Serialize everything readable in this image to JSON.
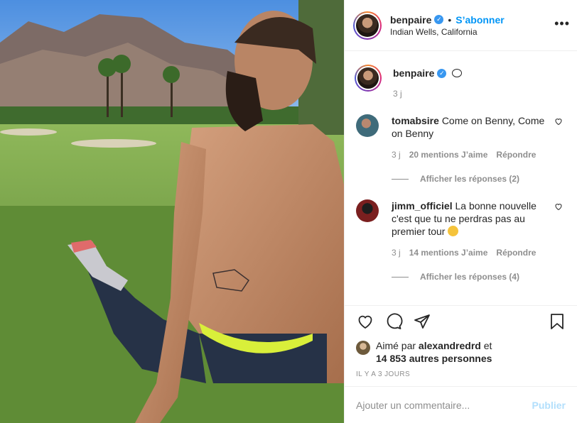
{
  "post": {
    "username": "benpaire",
    "follow_label": "S’abonner",
    "location": "Indian Wells, California",
    "more_label": "•••"
  },
  "caption": {
    "username": "benpaire",
    "time": "3 j"
  },
  "comments": [
    {
      "username": "tomabsire",
      "text": "Come on Benny, Come on Benny",
      "time": "3 j",
      "likes": "20 mentions J’aime",
      "reply_label": "Répondre",
      "view_replies": "Afficher les réponses (2)",
      "avatar_color": "#3f6b7a"
    },
    {
      "username": "jimm_officiel",
      "text": "La bonne nouvelle c'est que tu ne perdras pas au premier tour",
      "time": "3 j",
      "likes": "14 mentions J’aime",
      "reply_label": "Répondre",
      "view_replies": "Afficher les réponses (4)",
      "avatar_color": "#7a1f1f"
    }
  ],
  "likes": {
    "prefix": "Aimé par",
    "user": "alexandredrd",
    "joiner": "et",
    "others": "14 853 autres personnes"
  },
  "ago": "IL Y A 3 JOURS",
  "add_comment": {
    "placeholder": "Ajouter un commentaire...",
    "publish_label": "Publier"
  },
  "colors": {
    "accent": "#0095f6",
    "verified": "#3897f0",
    "muted": "#8e8e8e",
    "publish_disabled": "#b2dffc"
  }
}
